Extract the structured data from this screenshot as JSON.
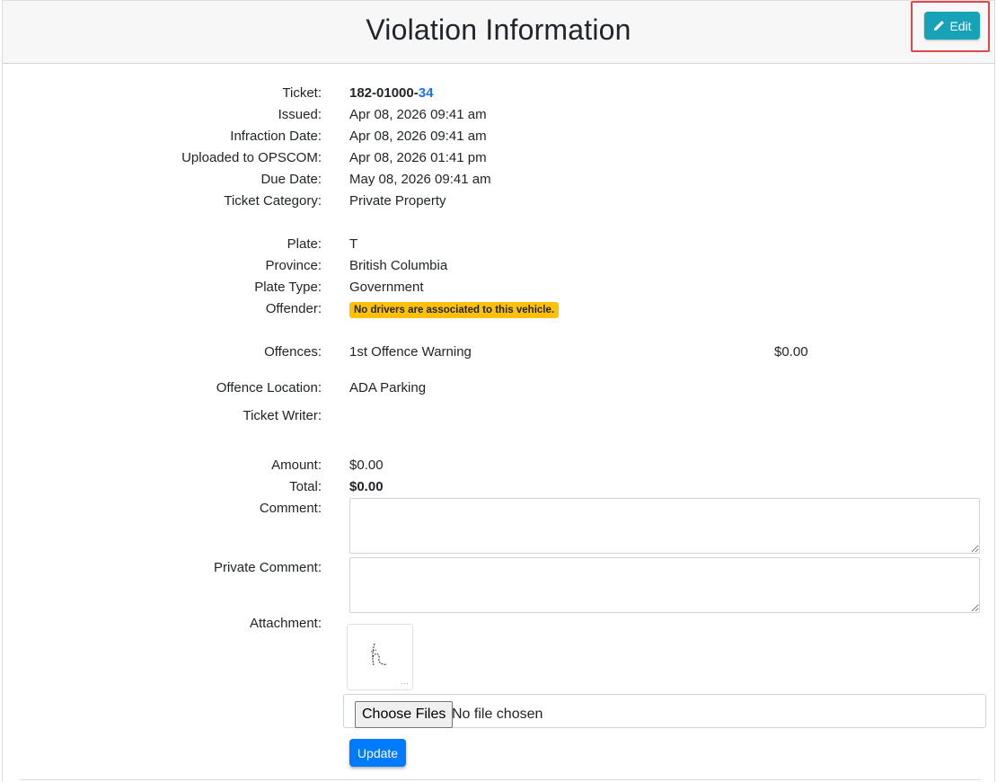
{
  "header": {
    "title": "Violation Information",
    "edit_label": "Edit"
  },
  "ticket": {
    "label": "Ticket:",
    "number_prefix": "182-01000-",
    "number_suffix": "34"
  },
  "fields": {
    "issued": {
      "label": "Issued:",
      "value": "Apr 08, 2026 09:41 am"
    },
    "infraction_date": {
      "label": "Infraction Date:",
      "value": "Apr 08, 2026 09:41 am"
    },
    "uploaded": {
      "label": "Uploaded to OPSCOM:",
      "value": "Apr 08, 2026 01:41 pm"
    },
    "due_date": {
      "label": "Due Date:",
      "value": "May 08, 2026 09:41 am"
    },
    "category": {
      "label": "Ticket Category:",
      "value": "Private Property"
    },
    "plate": {
      "label": "Plate:",
      "value": "T"
    },
    "province": {
      "label": "Province:",
      "value": "British Columbia"
    },
    "plate_type": {
      "label": "Plate Type:",
      "value": "Government"
    },
    "offender": {
      "label": "Offender:",
      "badge": "No drivers are associated to this vehicle."
    },
    "offences": {
      "label": "Offences:",
      "value": "1st Offence Warning",
      "fee": "$0.00"
    },
    "location": {
      "label": "Offence Location:",
      "value": "ADA Parking"
    },
    "writer": {
      "label": "Ticket Writer:",
      "value": ""
    },
    "amount": {
      "label": "Amount:",
      "value": "$0.00"
    },
    "total": {
      "label": "Total:",
      "value": "$0.00"
    },
    "comment": {
      "label": "Comment:",
      "value": ""
    },
    "private_comment": {
      "label": "Private Comment:",
      "value": ""
    },
    "attachment": {
      "label": "Attachment:"
    }
  },
  "file_input": {
    "button": "Choose Files",
    "status": "No file chosen"
  },
  "update_label": "Update",
  "colors": {
    "edit_button": "#17a2b8",
    "update_button": "#007bff",
    "badge": "#ffc107",
    "ticket_suffix": "#1a73e8",
    "highlight": "#e0474c"
  }
}
